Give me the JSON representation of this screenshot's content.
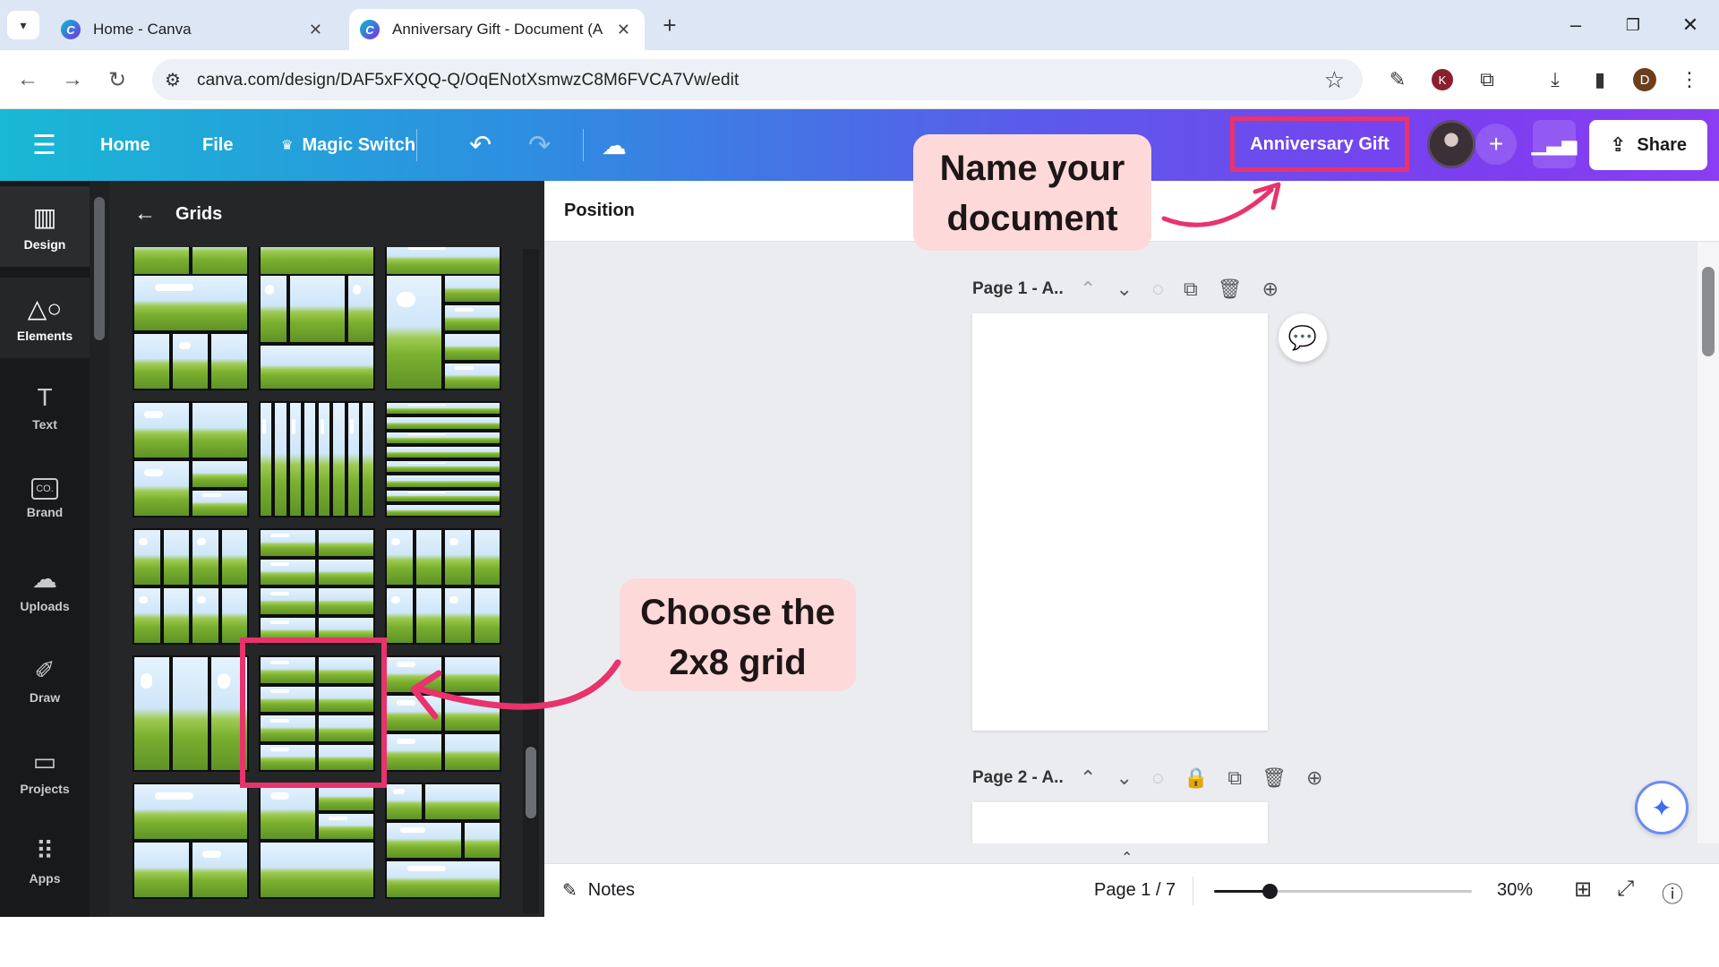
{
  "browser": {
    "tabs": [
      {
        "title": "Home - Canva",
        "active": false
      },
      {
        "title": "Anniversary Gift - Document (A",
        "active": true
      }
    ],
    "url": "canva.com/design/DAF5xFXQQ-Q/OqENotXsmwzC8M6FVCA7Vw/edit",
    "profile_initial": "D",
    "extension_badge": "K"
  },
  "canva": {
    "nav": {
      "home": "Home",
      "file": "File",
      "magic_switch": "Magic Switch"
    },
    "document_name": "Anniversary Gift",
    "share_label": "Share",
    "rail": [
      {
        "label": "Design"
      },
      {
        "label": "Elements"
      },
      {
        "label": "Text"
      },
      {
        "label": "Brand"
      },
      {
        "label": "Uploads"
      },
      {
        "label": "Draw"
      },
      {
        "label": "Projects"
      },
      {
        "label": "Apps"
      }
    ],
    "brand_badge": "CO.",
    "panel_title": "Grids",
    "toolbar_label": "Position",
    "pages": [
      {
        "label": "Page 1 - A.."
      },
      {
        "label": "Page 2 - A.."
      }
    ],
    "footer": {
      "notes": "Notes",
      "page_indicator": "Page 1 / 7",
      "zoom": "30%",
      "zoom_fraction": 0.3
    }
  },
  "annotations": {
    "callout_name": "Name your document",
    "callout_grid": "Choose the 2x8 grid",
    "highlight_color": "#e8336d",
    "callout_bg": "#fdd9d9"
  }
}
